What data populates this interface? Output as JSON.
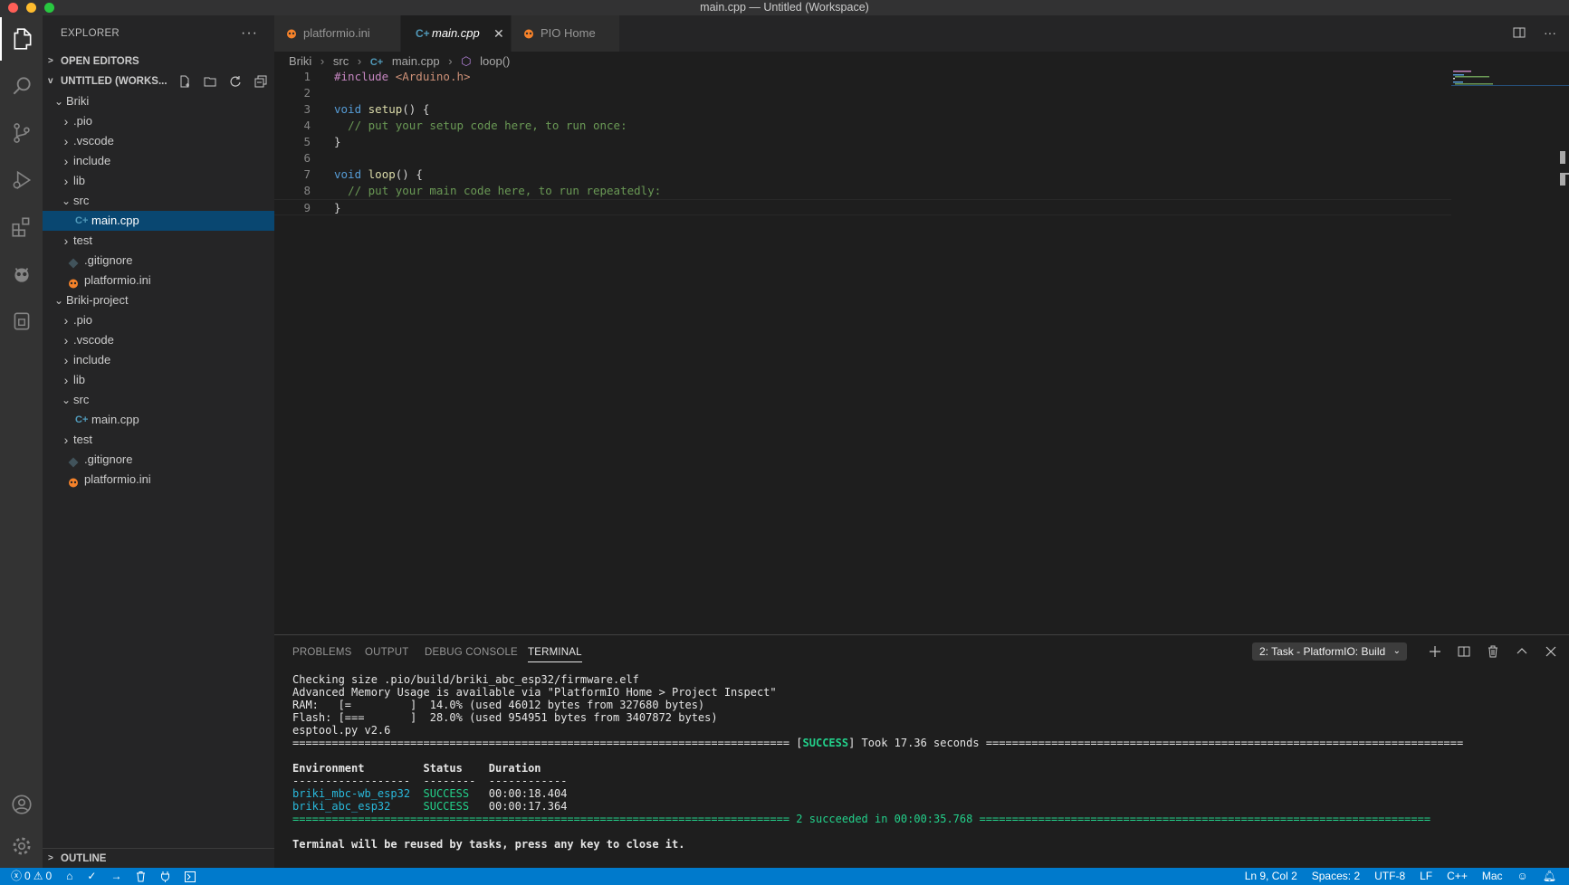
{
  "window": {
    "title": "main.cpp — Untitled (Workspace)"
  },
  "activity_bar": {
    "items": [
      "explorer-icon",
      "search-icon",
      "source-control-icon",
      "run-debug-icon",
      "extensions-icon",
      "platformio-icon",
      "remote-icon"
    ],
    "bottom": [
      "account-icon",
      "settings-gear-icon"
    ]
  },
  "sidebar": {
    "title": "EXPLORER",
    "open_editors": "OPEN EDITORS",
    "workspace": "UNTITLED (WORKS...",
    "tree": [
      {
        "label": "Briki",
        "twist": "v",
        "indent": 0,
        "icon": ""
      },
      {
        "label": ".pio",
        "twist": ">",
        "indent": 1,
        "icon": ""
      },
      {
        "label": ".vscode",
        "twist": ">",
        "indent": 1,
        "icon": ""
      },
      {
        "label": "include",
        "twist": ">",
        "indent": 1,
        "icon": ""
      },
      {
        "label": "lib",
        "twist": ">",
        "indent": 1,
        "icon": ""
      },
      {
        "label": "src",
        "twist": "v",
        "indent": 1,
        "icon": ""
      },
      {
        "label": "main.cpp",
        "twist": "",
        "indent": 2,
        "icon": "cpp",
        "selected": true
      },
      {
        "label": "test",
        "twist": ">",
        "indent": 1,
        "icon": ""
      },
      {
        "label": ".gitignore",
        "twist": "",
        "indent": 1,
        "icon": "git"
      },
      {
        "label": "platformio.ini",
        "twist": "",
        "indent": 1,
        "icon": "pio"
      },
      {
        "label": "Briki-project",
        "twist": "v",
        "indent": 0,
        "icon": ""
      },
      {
        "label": ".pio",
        "twist": ">",
        "indent": 1,
        "icon": ""
      },
      {
        "label": ".vscode",
        "twist": ">",
        "indent": 1,
        "icon": ""
      },
      {
        "label": "include",
        "twist": ">",
        "indent": 1,
        "icon": ""
      },
      {
        "label": "lib",
        "twist": ">",
        "indent": 1,
        "icon": ""
      },
      {
        "label": "src",
        "twist": "v",
        "indent": 1,
        "icon": ""
      },
      {
        "label": "main.cpp",
        "twist": "",
        "indent": 2,
        "icon": "cpp"
      },
      {
        "label": "test",
        "twist": ">",
        "indent": 1,
        "icon": ""
      },
      {
        "label": ".gitignore",
        "twist": "",
        "indent": 1,
        "icon": "git"
      },
      {
        "label": "platformio.ini",
        "twist": "",
        "indent": 1,
        "icon": "pio"
      }
    ],
    "outline": "OUTLINE"
  },
  "tabs": [
    {
      "label": "platformio.ini",
      "icon": "pio",
      "active": false
    },
    {
      "label": "main.cpp",
      "icon": "cpp",
      "active": true
    },
    {
      "label": "PIO Home",
      "icon": "pio",
      "active": false
    }
  ],
  "breadcrumb": {
    "items": [
      "Briki",
      "src",
      "main.cpp",
      "loop()"
    ]
  },
  "code": [
    {
      "n": "1",
      "parts": [
        [
          "pp",
          "#include "
        ],
        [
          "str",
          "<Arduino.h>"
        ]
      ]
    },
    {
      "n": "2",
      "parts": []
    },
    {
      "n": "3",
      "parts": [
        [
          "kw",
          "void "
        ],
        [
          "fn",
          "setup"
        ],
        [
          "",
          "() {"
        ]
      ]
    },
    {
      "n": "4",
      "parts": [
        [
          "",
          "  "
        ],
        [
          "cm",
          "// put your setup code here, to run once:"
        ]
      ]
    },
    {
      "n": "5",
      "parts": [
        [
          "",
          "}"
        ]
      ]
    },
    {
      "n": "6",
      "parts": []
    },
    {
      "n": "7",
      "parts": [
        [
          "kw",
          "void "
        ],
        [
          "fn",
          "loop"
        ],
        [
          "",
          "() {"
        ]
      ]
    },
    {
      "n": "8",
      "parts": [
        [
          "",
          "  "
        ],
        [
          "cm",
          "// put your main code here, to run repeatedly:"
        ]
      ]
    },
    {
      "n": "9",
      "parts": [
        [
          "",
          "}"
        ]
      ]
    }
  ],
  "panel": {
    "tabs": [
      "PROBLEMS",
      "OUTPUT",
      "DEBUG CONSOLE",
      "TERMINAL"
    ],
    "active_tab": "TERMINAL",
    "terminal_select": "2: Task - PlatformIO: Build",
    "terminal_lines": [
      [
        [
          "",
          "Checking size .pio/build/briki_abc_esp32/firmware.elf"
        ]
      ],
      [
        [
          "",
          "Advanced Memory Usage is available via \"PlatformIO Home > Project Inspect\""
        ]
      ],
      [
        [
          "",
          "RAM:   [=         ]  14.0% (used 46012 bytes from 327680 bytes)"
        ]
      ],
      [
        [
          "",
          "Flash: [===       ]  28.0% (used 954951 bytes from 3407872 bytes)"
        ]
      ],
      [
        [
          "",
          "esptool.py v2.6"
        ]
      ],
      [
        [
          "",
          "============================================================================ ["
        ],
        [
          "green bold",
          "SUCCESS"
        ],
        [
          "",
          "] Took 17.36 seconds ========================================================================="
        ]
      ],
      [
        [
          "",
          ""
        ]
      ],
      [
        [
          "bold",
          "Environment         Status    Duration"
        ]
      ],
      [
        [
          "",
          "------------------  --------  ------------"
        ]
      ],
      [
        [
          "cyan",
          "briki_mbc-wb_esp32"
        ],
        [
          "",
          "  "
        ],
        [
          "green",
          "SUCCESS"
        ],
        [
          "",
          "   00:00:18.404"
        ]
      ],
      [
        [
          "cyan",
          "briki_abc_esp32"
        ],
        [
          "",
          "     "
        ],
        [
          "green",
          "SUCCESS"
        ],
        [
          "",
          "   00:00:17.364"
        ]
      ],
      [
        [
          "green",
          "============================================================================ 2 succeeded in 00:00:35.768 ====================================================================="
        ]
      ],
      [
        [
          "",
          ""
        ]
      ],
      [
        [
          "bold",
          "Terminal will be reused by tasks, press any key to close it."
        ]
      ]
    ]
  },
  "statusbar": {
    "errors": "0",
    "warnings": "0",
    "position": "Ln 9, Col 2",
    "spaces": "Spaces: 2",
    "encoding": "UTF-8",
    "eol": "LF",
    "language": "C++",
    "platform": "Mac"
  },
  "colors": {
    "accent": "#007acc",
    "selection": "#094771",
    "pio": "#f5822a"
  }
}
